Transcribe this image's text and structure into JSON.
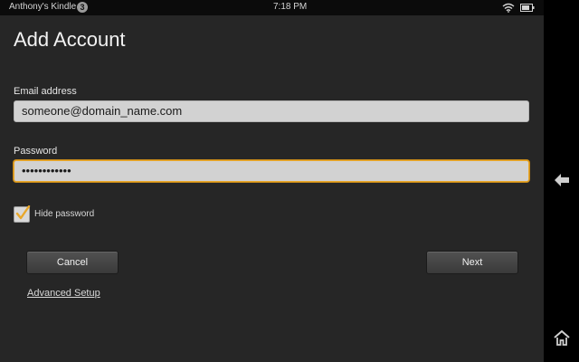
{
  "status_bar": {
    "device_name": "Anthony's Kindle",
    "notification_count": "3",
    "time": "7:18 PM",
    "icons": [
      "wifi-icon",
      "battery-icon"
    ]
  },
  "page": {
    "title": "Add Account"
  },
  "form": {
    "email_label": "Email address",
    "email_value": "someone@domain_name.com",
    "password_label": "Password",
    "password_value": "••••••••••••",
    "hide_password_label": "Hide password",
    "hide_password_checked": true
  },
  "buttons": {
    "cancel_label": "Cancel",
    "next_label": "Next"
  },
  "links": {
    "advanced_setup": "Advanced Setup"
  },
  "side_nav": {
    "icons": [
      "back-arrow-icon",
      "home-icon"
    ]
  },
  "colors": {
    "background": "#262626",
    "focus_border": "#e8a72a",
    "check_color": "#e8a72a"
  }
}
